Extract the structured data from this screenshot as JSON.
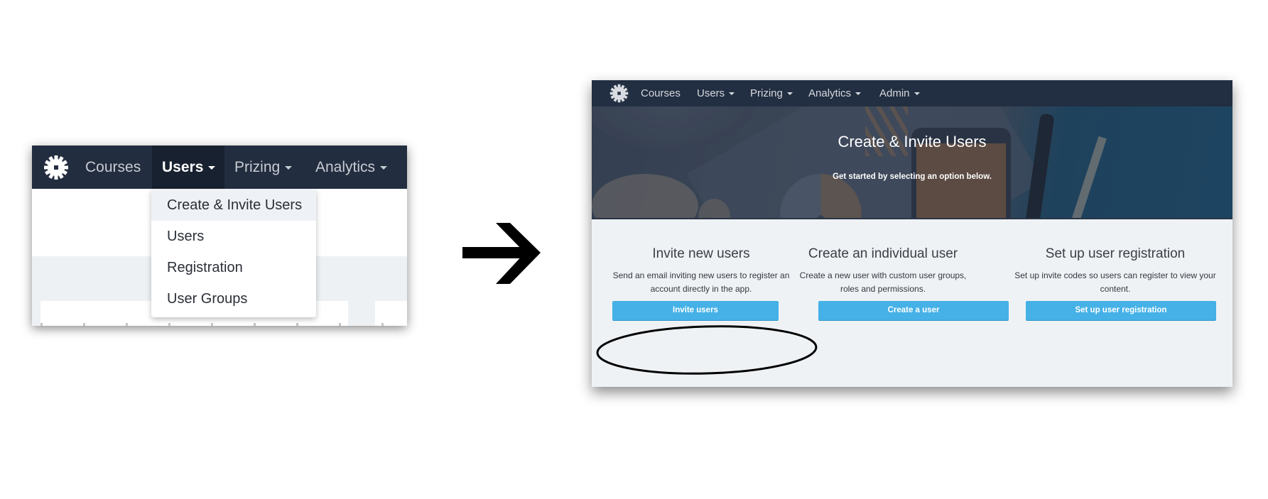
{
  "left_panel": {
    "nav": {
      "logo_icon": "gear-icon",
      "items": [
        {
          "label": "Courses",
          "dropdown": false
        },
        {
          "label": "Users",
          "dropdown": true,
          "active": true
        },
        {
          "label": "Prizing",
          "dropdown": true
        },
        {
          "label": "Analytics",
          "dropdown": true
        }
      ]
    },
    "dropdown": {
      "items": [
        {
          "label": "Create & Invite Users",
          "highlighted": true
        },
        {
          "label": "Users"
        },
        {
          "label": "Registration"
        },
        {
          "label": "User Groups"
        }
      ]
    }
  },
  "transition_icon": "arrow-right-icon",
  "right_panel": {
    "nav": {
      "logo_icon": "gear-icon",
      "items": [
        {
          "label": "Courses",
          "dropdown": false
        },
        {
          "label": "Users",
          "dropdown": true
        },
        {
          "label": "Prizing",
          "dropdown": true
        },
        {
          "label": "Analytics",
          "dropdown": true
        },
        {
          "label": "Admin",
          "dropdown": true
        }
      ]
    },
    "hero": {
      "title": "Create & Invite Users",
      "subtitle": "Get started by selecting an option below."
    },
    "options": [
      {
        "heading": "Invite new users",
        "description": "Send an email inviting new users to register an account directly in the app.",
        "button": "Invite users",
        "circled": true
      },
      {
        "heading": "Create an individual user",
        "description": "Create a new user with custom user groups, roles and permissions.",
        "button": "Create a user"
      },
      {
        "heading": "Set up user registration",
        "description": "Set up invite codes so users can register to view your content.",
        "button": "Set up user registration"
      }
    ]
  },
  "colors": {
    "nav_bg": "#222e41",
    "nav_active_bg": "#182130",
    "button_bg": "#45b1e7",
    "content_bg": "#eff2f5",
    "annotation": "#000000"
  }
}
